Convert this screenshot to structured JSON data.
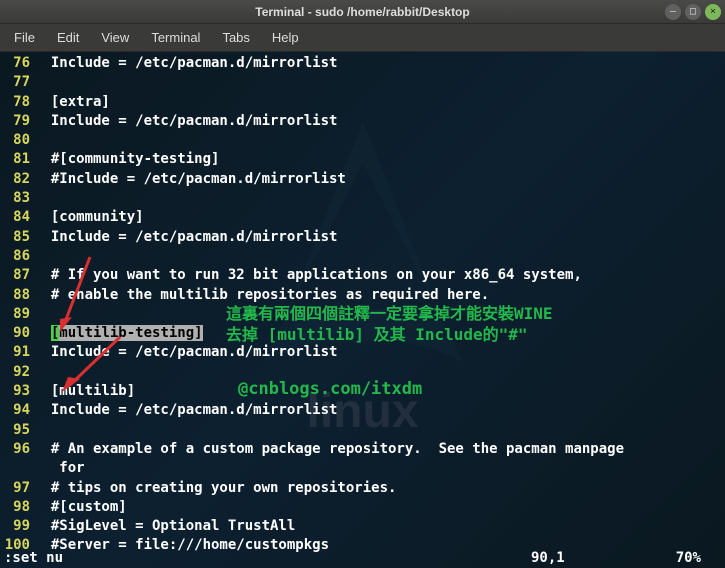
{
  "window": {
    "title": "Terminal - sudo  /home/rabbit/Desktop"
  },
  "menu": {
    "file": "File",
    "edit": "Edit",
    "view": "View",
    "terminal": "Terminal",
    "tabs": "Tabs",
    "help": "Help"
  },
  "lines": [
    {
      "n": "76",
      "t": "Include = /etc/pacman.d/mirrorlist"
    },
    {
      "n": "77",
      "t": ""
    },
    {
      "n": "78",
      "t": "[extra]"
    },
    {
      "n": "79",
      "t": "Include = /etc/pacman.d/mirrorlist"
    },
    {
      "n": "80",
      "t": ""
    },
    {
      "n": "81",
      "t": "#[community-testing]"
    },
    {
      "n": "82",
      "t": "#Include = /etc/pacman.d/mirrorlist"
    },
    {
      "n": "83",
      "t": ""
    },
    {
      "n": "84",
      "t": "[community]"
    },
    {
      "n": "85",
      "t": "Include = /etc/pacman.d/mirrorlist"
    },
    {
      "n": "86",
      "t": ""
    },
    {
      "n": "87",
      "t": "# If you want to run 32 bit applications on your x86_64 system,"
    },
    {
      "n": "88",
      "t": "# enable the multilib repositories as required here."
    },
    {
      "n": "89",
      "t": ""
    },
    {
      "n": "90",
      "t": "[multilib-testing]"
    },
    {
      "n": "91",
      "t": "Include = /etc/pacman.d/mirrorlist"
    },
    {
      "n": "92",
      "t": ""
    },
    {
      "n": "93",
      "t": "[multilib]"
    },
    {
      "n": "94",
      "t": "Include = /etc/pacman.d/mirrorlist"
    },
    {
      "n": "95",
      "t": ""
    },
    {
      "n": "96",
      "t": "# An example of a custom package repository.  See the pacman manpage for"
    },
    {
      "n": "97",
      "t": "# tips on creating your own repositories."
    },
    {
      "n": "98",
      "t": "#[custom]"
    },
    {
      "n": "99",
      "t": "#SigLevel = Optional TrustAll"
    },
    {
      "n": "100",
      "t": "#Server = file:///home/custompkgs"
    }
  ],
  "status": {
    "cmd": ":set nu",
    "pos": "90,1",
    "pct": "70%"
  },
  "annotations": {
    "line1": "這裏有兩個四個註釋一定要拿掉才能安裝WINE",
    "line2": "去掉 [multilib] 及其 Include的\"#\"",
    "watermark": "@cnblogs.com/itxdm"
  },
  "bg_brand": "linux"
}
